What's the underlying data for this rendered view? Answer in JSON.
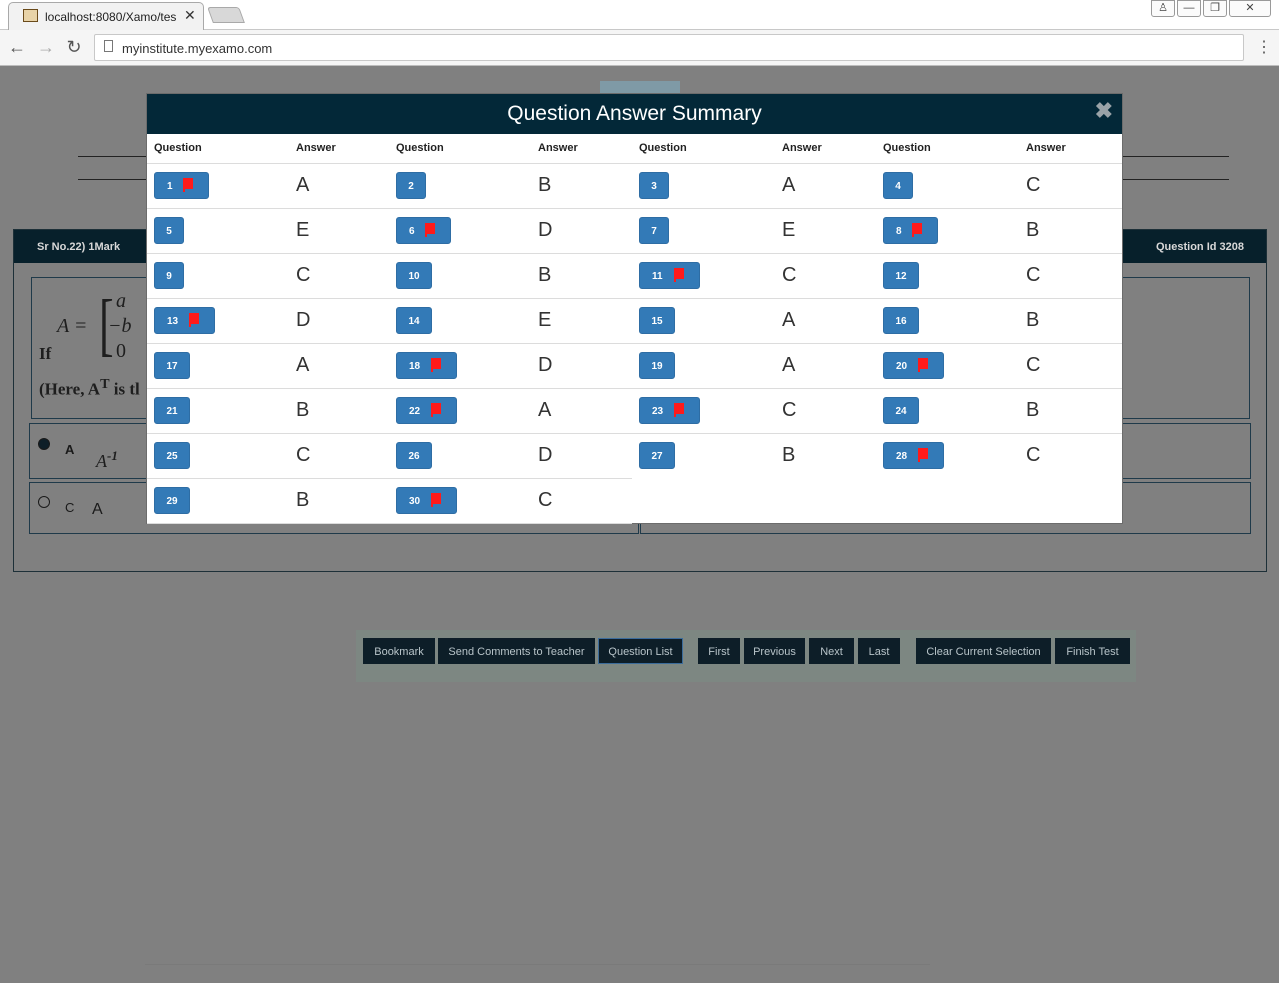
{
  "browser": {
    "tab_title": "localhost:8080/Xamo/tes",
    "tab_close": "✕",
    "url": "myinstitute.myexamo.com",
    "back": "←",
    "forward": "→",
    "reload": "↻",
    "menu": "⋮",
    "window_user": "♙",
    "window_min": "—",
    "window_restore": "❐",
    "window_close": "✕"
  },
  "question": {
    "serial": "Sr No.22) 1Mark",
    "question_id": "Question Id 3208",
    "if_word": "If",
    "matrix_lhs": "A =",
    "matrix_col": [
      "a",
      "−b",
      "0"
    ],
    "note": "(Here, A",
    "note_sup": "T",
    "note_tail": " is tl",
    "option_a_letter": "A",
    "option_a_value": "A",
    "option_a_sup": "-1",
    "option_c_letter": "C",
    "option_c_value": "A"
  },
  "actions": {
    "bookmark": "Bookmark",
    "send_comments": "Send Comments to Teacher",
    "question_list": "Question List",
    "first": "First",
    "previous": "Previous",
    "next": "Next",
    "last": "Last",
    "clear_selection": "Clear Current Selection",
    "finish_test": "Finish Test"
  },
  "modal": {
    "title": "Question Answer Summary",
    "close": "✖",
    "col_question": "Question",
    "col_answer": "Answer",
    "accent_color": "#337ab7",
    "header_color": "#032838",
    "bookmark_color": "#ff1a1a",
    "items": [
      {
        "q": "1",
        "a": "A",
        "bookmarked": true
      },
      {
        "q": "2",
        "a": "B",
        "bookmarked": false
      },
      {
        "q": "3",
        "a": "A",
        "bookmarked": false
      },
      {
        "q": "4",
        "a": "C",
        "bookmarked": false
      },
      {
        "q": "5",
        "a": "E",
        "bookmarked": false
      },
      {
        "q": "6",
        "a": "D",
        "bookmarked": true
      },
      {
        "q": "7",
        "a": "E",
        "bookmarked": false
      },
      {
        "q": "8",
        "a": "B",
        "bookmarked": true
      },
      {
        "q": "9",
        "a": "C",
        "bookmarked": false
      },
      {
        "q": "10",
        "a": "B",
        "bookmarked": false
      },
      {
        "q": "11",
        "a": "C",
        "bookmarked": true
      },
      {
        "q": "12",
        "a": "C",
        "bookmarked": false
      },
      {
        "q": "13",
        "a": "D",
        "bookmarked": true
      },
      {
        "q": "14",
        "a": "E",
        "bookmarked": false
      },
      {
        "q": "15",
        "a": "A",
        "bookmarked": false
      },
      {
        "q": "16",
        "a": "B",
        "bookmarked": false
      },
      {
        "q": "17",
        "a": "A",
        "bookmarked": false
      },
      {
        "q": "18",
        "a": "D",
        "bookmarked": true
      },
      {
        "q": "19",
        "a": "A",
        "bookmarked": false
      },
      {
        "q": "20",
        "a": "C",
        "bookmarked": true
      },
      {
        "q": "21",
        "a": "B",
        "bookmarked": false
      },
      {
        "q": "22",
        "a": "A",
        "bookmarked": true
      },
      {
        "q": "23",
        "a": "C",
        "bookmarked": true
      },
      {
        "q": "24",
        "a": "B",
        "bookmarked": false
      },
      {
        "q": "25",
        "a": "C",
        "bookmarked": false
      },
      {
        "q": "26",
        "a": "D",
        "bookmarked": false
      },
      {
        "q": "27",
        "a": "B",
        "bookmarked": false
      },
      {
        "q": "28",
        "a": "C",
        "bookmarked": true
      },
      {
        "q": "29",
        "a": "B",
        "bookmarked": false
      },
      {
        "q": "30",
        "a": "C",
        "bookmarked": true
      }
    ]
  }
}
